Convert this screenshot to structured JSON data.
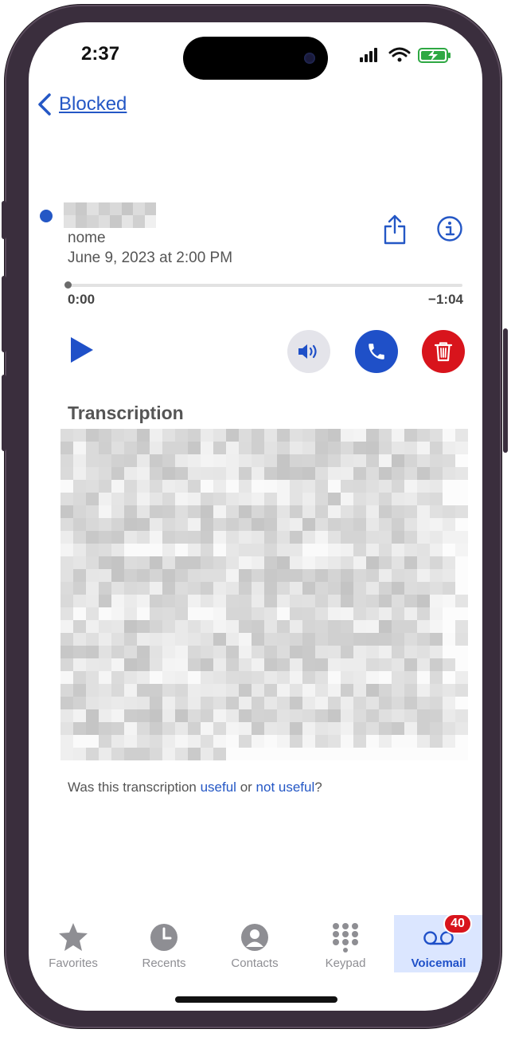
{
  "status_bar": {
    "time": "2:37"
  },
  "nav": {
    "back_label": "Blocked"
  },
  "voicemail": {
    "caller_label": "nome",
    "date": "June 9, 2023 at 2:00 PM",
    "elapsed": "0:00",
    "remaining": "−1:04",
    "progress": 0
  },
  "transcription": {
    "title": "Transcription",
    "feedback_prefix": "Was this transcription ",
    "useful_label": "useful",
    "feedback_or": " or ",
    "not_useful_label": "not useful",
    "feedback_suffix": "?"
  },
  "tabs": [
    {
      "label": "Favorites",
      "icon": "star-icon"
    },
    {
      "label": "Recents",
      "icon": "clock-icon"
    },
    {
      "label": "Contacts",
      "icon": "person-icon"
    },
    {
      "label": "Keypad",
      "icon": "keypad-icon"
    },
    {
      "label": "Voicemail",
      "icon": "voicemail-icon",
      "badge": "40",
      "active": true
    }
  ],
  "colors": {
    "accent": "#2457c5",
    "delete": "#d8141c",
    "call": "#1f50c8"
  }
}
